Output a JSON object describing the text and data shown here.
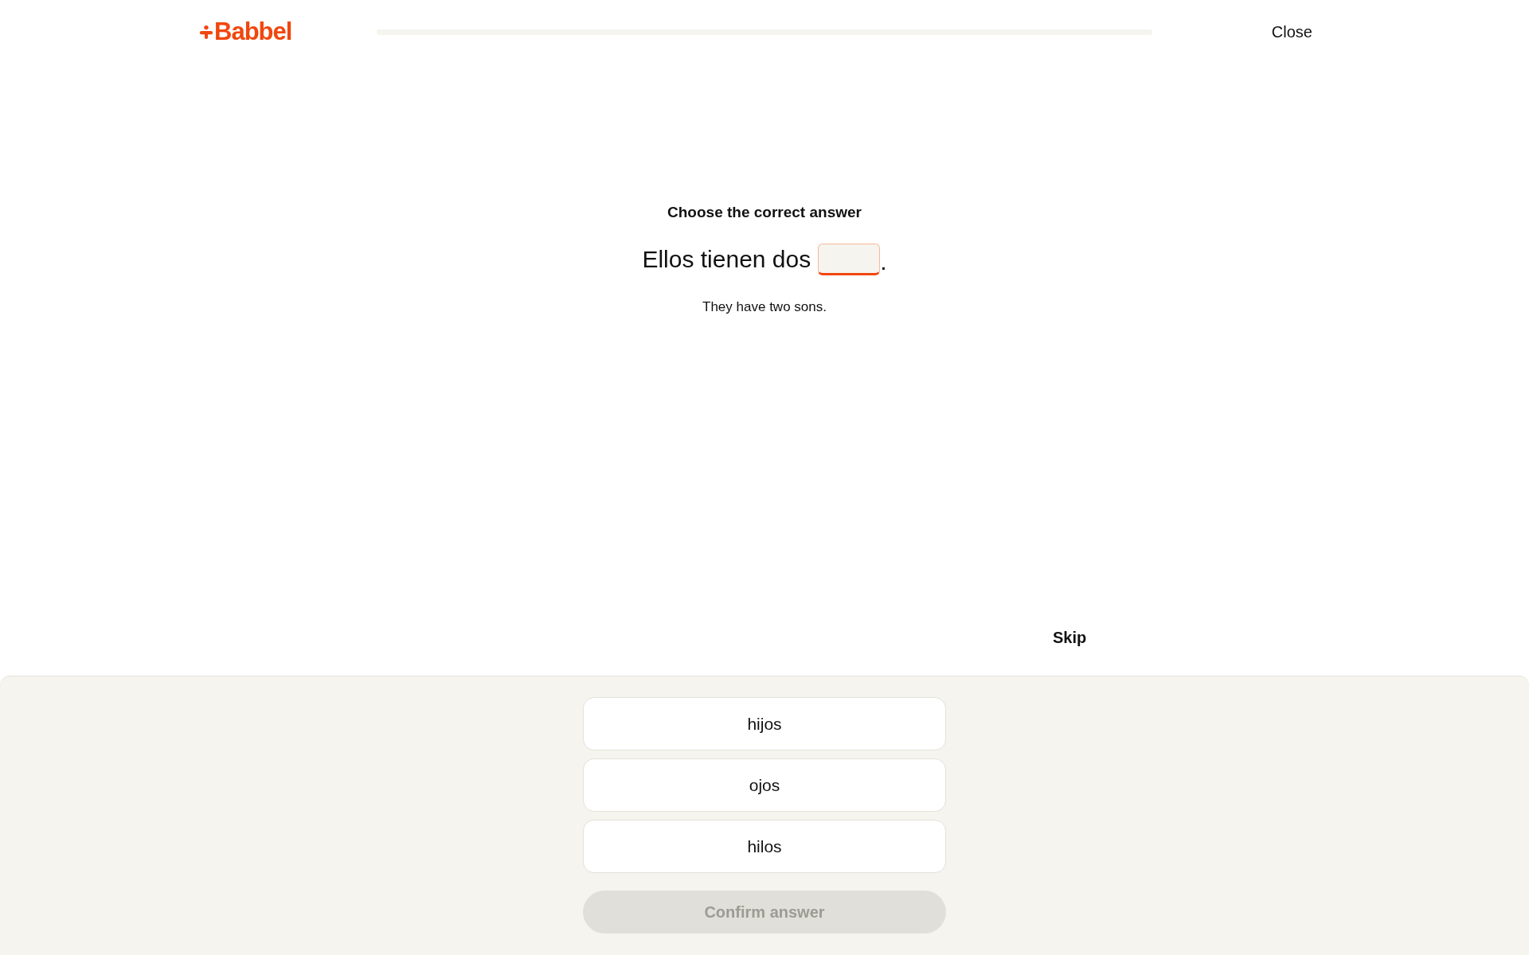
{
  "header": {
    "logo": "Babbel",
    "progress": {
      "level": 0
    },
    "close": "Close"
  },
  "exercise": {
    "instruction": "Choose the correct answer",
    "sentence_before": "Ellos tienen dos",
    "sentence_after": ".",
    "translation": "They have two sons.",
    "skip": "Skip"
  },
  "options": [
    {
      "label": "hijos",
      "selected": false
    },
    {
      "label": "ojos",
      "selected": false
    },
    {
      "label": "hilos",
      "selected": false
    }
  ],
  "confirm": {
    "label": "Confirm answer",
    "disabled": true
  }
}
